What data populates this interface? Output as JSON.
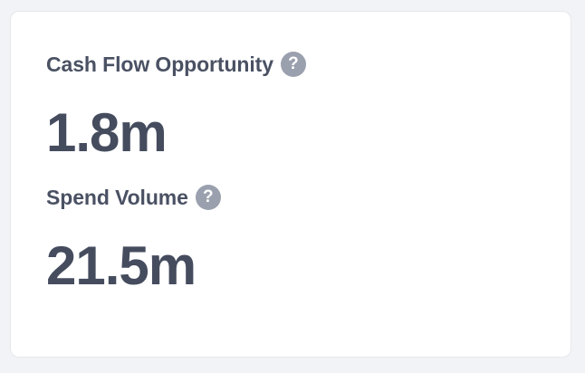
{
  "metrics": [
    {
      "label": "Cash Flow Opportunity",
      "help_icon": "?",
      "value": "1.8m"
    },
    {
      "label": "Spend Volume",
      "help_icon": "?",
      "value": "21.5m"
    }
  ],
  "colors": {
    "page_background": "#f2f3f6",
    "card_background": "#ffffff",
    "label_text": "#4a5163",
    "value_text": "#454c5e",
    "help_icon_background": "#9aa0ad"
  },
  "icons": {
    "help": "question-circle-icon"
  }
}
